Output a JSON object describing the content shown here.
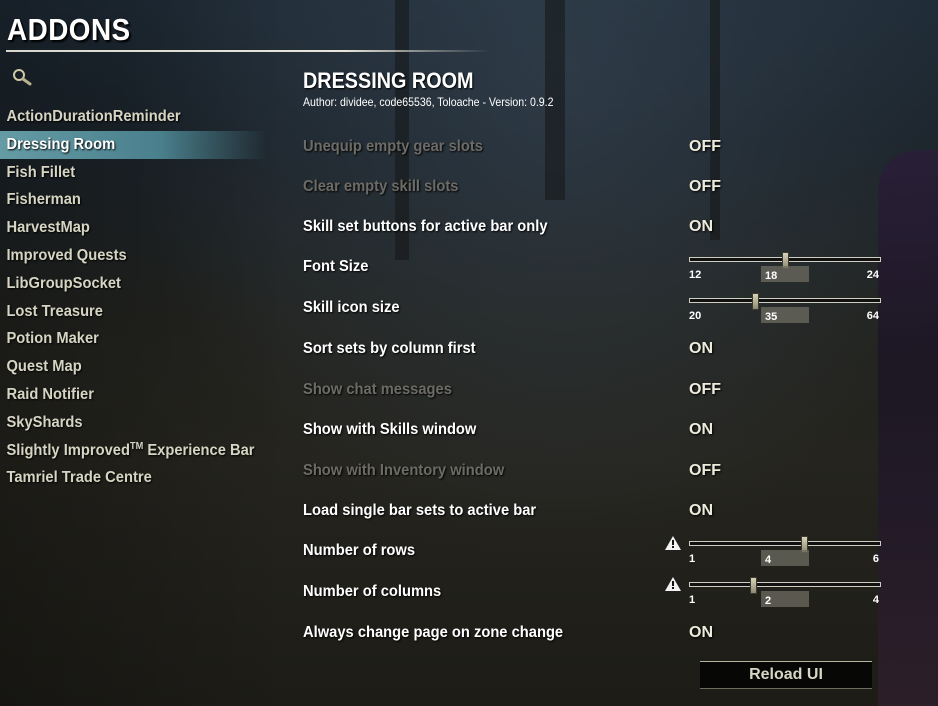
{
  "header": {
    "title": "ADDONS",
    "search_icon": "search-icon"
  },
  "sidebar": {
    "items": [
      {
        "label": "ActionDurationReminder",
        "selected": false
      },
      {
        "label": "Dressing Room",
        "selected": true
      },
      {
        "label": "Fish Fillet",
        "selected": false
      },
      {
        "label": "Fisherman",
        "selected": false
      },
      {
        "label": "HarvestMap",
        "selected": false
      },
      {
        "label": "Improved Quests",
        "selected": false
      },
      {
        "label": "LibGroupSocket",
        "selected": false
      },
      {
        "label": "Lost Treasure",
        "selected": false
      },
      {
        "label": "Potion Maker",
        "selected": false
      },
      {
        "label": "Quest Map",
        "selected": false
      },
      {
        "label": "Raid Notifier",
        "selected": false
      },
      {
        "label": "SkyShards",
        "selected": false
      },
      {
        "label": "Slightly Improved",
        "label_suffix": " Experience Bar",
        "trademark": "TM",
        "selected": false
      },
      {
        "label": "Tamriel Trade Centre",
        "selected": false
      }
    ]
  },
  "panel": {
    "title": "DRESSING ROOM",
    "author": "Author: dividee, code65536, Toloache - Version: 0.9.2",
    "settings": [
      {
        "label": "Unequip empty gear slots",
        "type": "toggle",
        "value": "OFF",
        "enabled": false
      },
      {
        "label": "Clear empty skill slots",
        "type": "toggle",
        "value": "OFF",
        "enabled": false
      },
      {
        "label": "Skill set buttons for active bar only",
        "type": "toggle",
        "value": "ON",
        "enabled": true
      },
      {
        "label": "Font Size",
        "type": "slider",
        "min": "12",
        "max": "24",
        "value": "18",
        "enabled": true
      },
      {
        "label": "Skill icon size",
        "type": "slider",
        "min": "20",
        "max": "64",
        "value": "35",
        "enabled": true
      },
      {
        "label": "Sort sets by column first",
        "type": "toggle",
        "value": "ON",
        "enabled": true
      },
      {
        "label": "Show chat messages",
        "type": "toggle",
        "value": "OFF",
        "enabled": false
      },
      {
        "label": "Show with Skills window",
        "type": "toggle",
        "value": "ON",
        "enabled": true
      },
      {
        "label": "Show with Inventory window",
        "type": "toggle",
        "value": "OFF",
        "enabled": false
      },
      {
        "label": "Load single bar sets to active bar",
        "type": "toggle",
        "value": "ON",
        "enabled": true
      },
      {
        "label": "Number of rows",
        "type": "slider",
        "min": "1",
        "max": "6",
        "value": "4",
        "enabled": true,
        "warning": true
      },
      {
        "label": "Number of columns",
        "type": "slider",
        "min": "1",
        "max": "4",
        "value": "2",
        "enabled": true,
        "warning": true
      },
      {
        "label": "Always change page on zone change",
        "type": "toggle",
        "value": "ON",
        "enabled": true
      }
    ]
  },
  "footer": {
    "reload_label": "Reload UI"
  },
  "colors": {
    "selected_highlight": "#5aa0af",
    "disabled_text": "#6c6b66",
    "value_text": "#eeecdc"
  }
}
